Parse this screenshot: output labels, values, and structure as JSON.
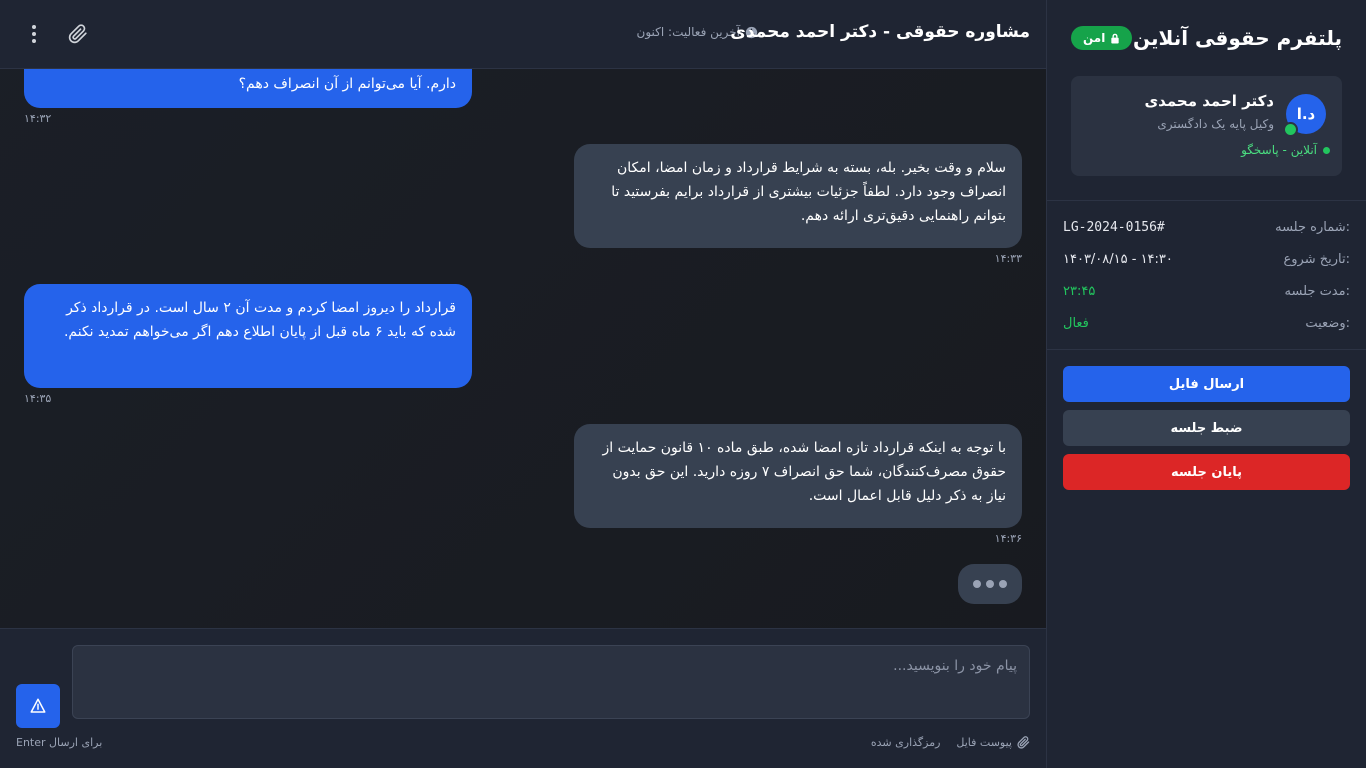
{
  "sidebar": {
    "title": "پلتفرم حقوقی آنلاین",
    "secure_badge": "امن",
    "lawyer": {
      "initials": "د.ا",
      "name": "دکتر احمد محمدی",
      "title": "وکیل پایه یک دادگستری",
      "status": "آنلاین - پاسخگو"
    },
    "session": {
      "id_label": "شماره جلسه:",
      "id_value": "LG-2024-0156#",
      "start_label": "تاریخ شروع:",
      "start_value": "۱۴۰۳/۰۸/۱۵ - ۱۴:۳۰",
      "duration_label": "مدت جلسه:",
      "duration_value": "۲۳:۴۵",
      "status_label": "وضعیت:",
      "status_value": "فعال"
    },
    "actions": {
      "send_file": "ارسال فایل",
      "record": "ضبط جلسه",
      "end": "پایان جلسه"
    }
  },
  "header": {
    "title": "مشاوره حقوقی - دکتر احمد محمدی",
    "last_active": "آخرین فعالیت: اکنون"
  },
  "messages": [
    {
      "sender": "user",
      "text": "دارم. آیا می‌توانم از آن انصراف دهم؟",
      "time": "۱۴:۳۲"
    },
    {
      "sender": "lawyer",
      "text": "سلام و وقت بخیر. بله، بسته به شرایط قرارداد و زمان امضا، امکان انصراف وجود دارد. لطفاً جزئیات بیشتری از قرارداد برایم بفرستید تا بتوانم راهنمایی دقیق‌تری ارائه دهم.",
      "time": "۱۴:۳۳"
    },
    {
      "sender": "user",
      "text": "قرارداد را دیروز امضا کردم و مدت آن ۲ سال است. در قرارداد ذکر شده که باید ۶ ماه قبل از پایان اطلاع دهم اگر می‌خواهم تمدید نکنم.",
      "time": "۱۴:۳۵"
    },
    {
      "sender": "lawyer",
      "text": "با توجه به اینکه قرارداد تازه امضا شده، طبق ماده ۱۰ قانون حمایت از حقوق مصرف‌کنندگان، شما حق انصراف ۷ روزه دارید. این حق بدون نیاز به ذکر دلیل قابل اعمال است.",
      "time": "۱۴:۳۶"
    }
  ],
  "composer": {
    "placeholder": "پیام خود را بنویسید...",
    "attach_label": "پیوست فایل",
    "encryption_label": "رمزگذاری شده",
    "enter_hint": "Enter برای ارسال"
  },
  "colors": {
    "accent": "#2563eb",
    "success": "#22c55e",
    "danger": "#dc2626"
  }
}
